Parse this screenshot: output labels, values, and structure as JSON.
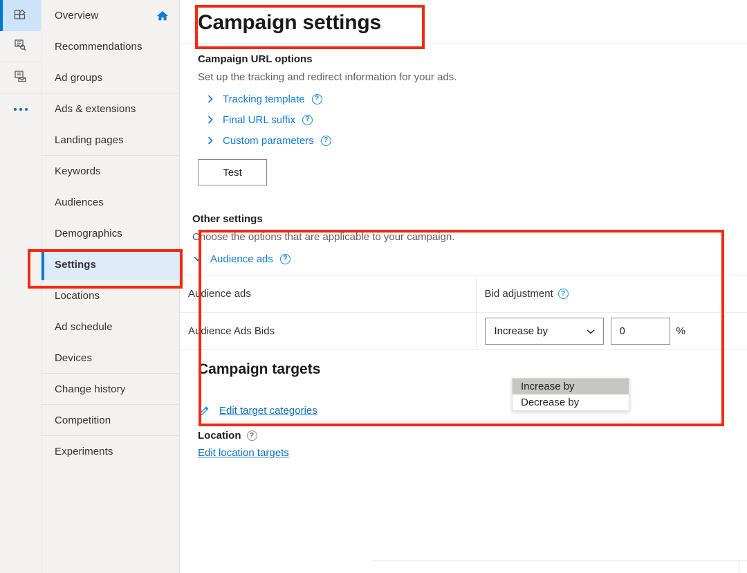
{
  "rail": {
    "items": [
      {
        "name": "overview-rail-icon",
        "icon": "dashboard-grid-icon",
        "selected": true
      },
      {
        "name": "recommendations-rail-icon",
        "icon": "pages-search-icon",
        "selected": false
      },
      {
        "name": "ads-rail-icon",
        "icon": "pages-stack-icon",
        "selected": false
      }
    ],
    "overflow_label": "..."
  },
  "sidebar": {
    "items": [
      {
        "label": "Overview",
        "active": false,
        "icon": "home-icon",
        "group_end": false
      },
      {
        "label": "Recommendations",
        "active": false,
        "icon": "",
        "group_end": false
      },
      {
        "label": "Ad groups",
        "active": false,
        "icon": "",
        "group_end": true
      },
      {
        "label": "Ads & extensions",
        "active": false,
        "icon": "",
        "group_end": false
      },
      {
        "label": "Landing pages",
        "active": false,
        "icon": "",
        "group_end": true
      },
      {
        "label": "Keywords",
        "active": false,
        "icon": "",
        "group_end": false
      },
      {
        "label": "Audiences",
        "active": false,
        "icon": "",
        "group_end": false
      },
      {
        "label": "Demographics",
        "active": false,
        "icon": "",
        "group_end": false
      },
      {
        "label": "Settings",
        "active": true,
        "icon": "",
        "group_end": false
      },
      {
        "label": "Locations",
        "active": false,
        "icon": "",
        "group_end": false
      },
      {
        "label": "Ad schedule",
        "active": false,
        "icon": "",
        "group_end": false
      },
      {
        "label": "Devices",
        "active": false,
        "icon": "",
        "group_end": true
      },
      {
        "label": "Change history",
        "active": false,
        "icon": "",
        "group_end": true
      },
      {
        "label": "Competition",
        "active": false,
        "icon": "",
        "group_end": true
      },
      {
        "label": "Experiments",
        "active": false,
        "icon": "",
        "group_end": false
      }
    ]
  },
  "page": {
    "title": "Campaign settings"
  },
  "url_options": {
    "heading": "Campaign URL options",
    "description": "Set up the tracking and redirect information for your ads.",
    "rows": [
      {
        "label": "Tracking template",
        "expanded": false,
        "help": "?"
      },
      {
        "label": "Final URL suffix",
        "expanded": false,
        "help": "?"
      },
      {
        "label": "Custom parameters",
        "expanded": false,
        "help": "?"
      }
    ],
    "test_button": "Test"
  },
  "other_settings": {
    "heading": "Other settings",
    "description": "Choose the options that are applicable to your campaign.",
    "audience_ads_link": "Audience ads",
    "audience_ads_help": "?",
    "table": {
      "headers": [
        "Audience ads",
        "Bid adjustment"
      ],
      "header_help": "?",
      "rows": [
        {
          "label": "Audience Ads Bids",
          "select_value": "Increase by",
          "amount_value": "0",
          "unit": "%"
        }
      ]
    },
    "dropdown": {
      "open": true,
      "options": [
        {
          "label": "Increase by",
          "highlighted": true
        },
        {
          "label": "Decrease by",
          "highlighted": false
        }
      ]
    }
  },
  "campaign_targets": {
    "heading": "Campaign targets",
    "edit_target_categories": "Edit target categories",
    "location_label": "Location",
    "location_help": "?",
    "edit_location_targets": "Edit location targets"
  },
  "colors": {
    "accent": "#0078d4",
    "link": "#0f7bd4",
    "highlight_box": "#f4290f",
    "active_nav_bg": "#deecf9",
    "rail_bg": "#f3f2f1"
  }
}
